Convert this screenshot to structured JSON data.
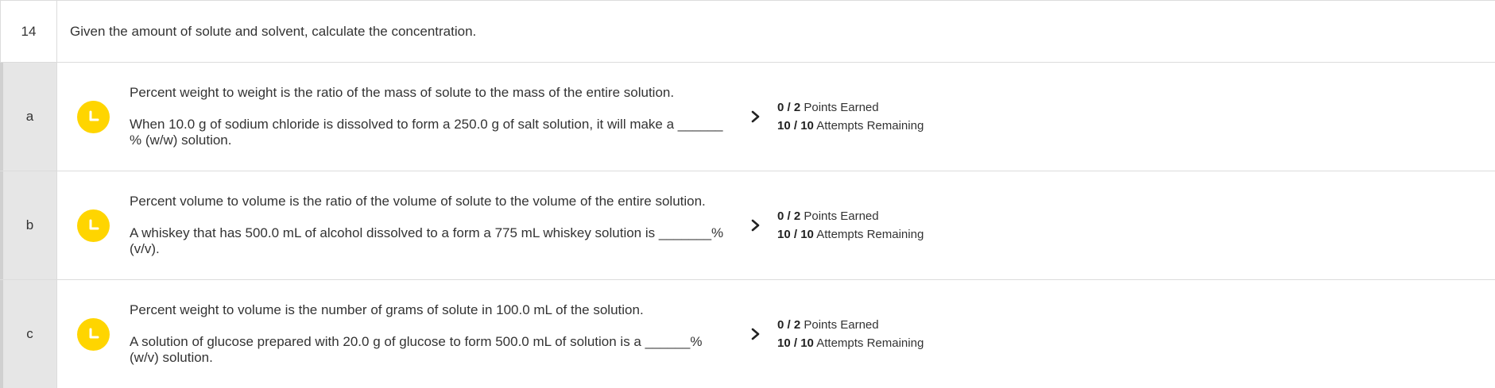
{
  "question": {
    "number": "14",
    "prompt": "Given the amount of solute and solvent, calculate the concentration."
  },
  "parts": [
    {
      "label": "a",
      "intro": "Percent weight to weight is the ratio of the mass of solute to the mass of the entire solution.",
      "question": "When 10.0 g of sodium chloride is dissolved to form a 250.0 g of salt solution, it will make a ______ % (w/w) solution.",
      "points_earned": "0",
      "points_total": "2",
      "points_label": "Points Earned",
      "attempts_remaining": "10",
      "attempts_total": "10",
      "attempts_label": "Attempts Remaining",
      "status_icon": "clock-icon"
    },
    {
      "label": "b",
      "intro": "Percent volume to volume is the ratio of the volume of solute to the volume of the entire solution.",
      "question": "A whiskey that has 500.0 mL of alcohol dissolved to a form a 775 mL whiskey solution is _______% (v/v).",
      "points_earned": "0",
      "points_total": "2",
      "points_label": "Points Earned",
      "attempts_remaining": "10",
      "attempts_total": "10",
      "attempts_label": "Attempts Remaining",
      "status_icon": "clock-icon"
    },
    {
      "label": "c",
      "intro": "Percent weight to volume is the number of grams of solute in 100.0 mL of the solution.",
      "question": "A solution of glucose prepared with 20.0 g of glucose to form 500.0 mL of solution is a ______% (w/v) solution.",
      "points_earned": "0",
      "points_total": "2",
      "points_label": "Points Earned",
      "attempts_remaining": "10",
      "attempts_total": "10",
      "attempts_label": "Attempts Remaining",
      "status_icon": "clock-icon"
    }
  ],
  "colors": {
    "status_yellow": "#ffd500",
    "label_column_bg": "#e6e6e6",
    "border": "#dcdcdc"
  }
}
